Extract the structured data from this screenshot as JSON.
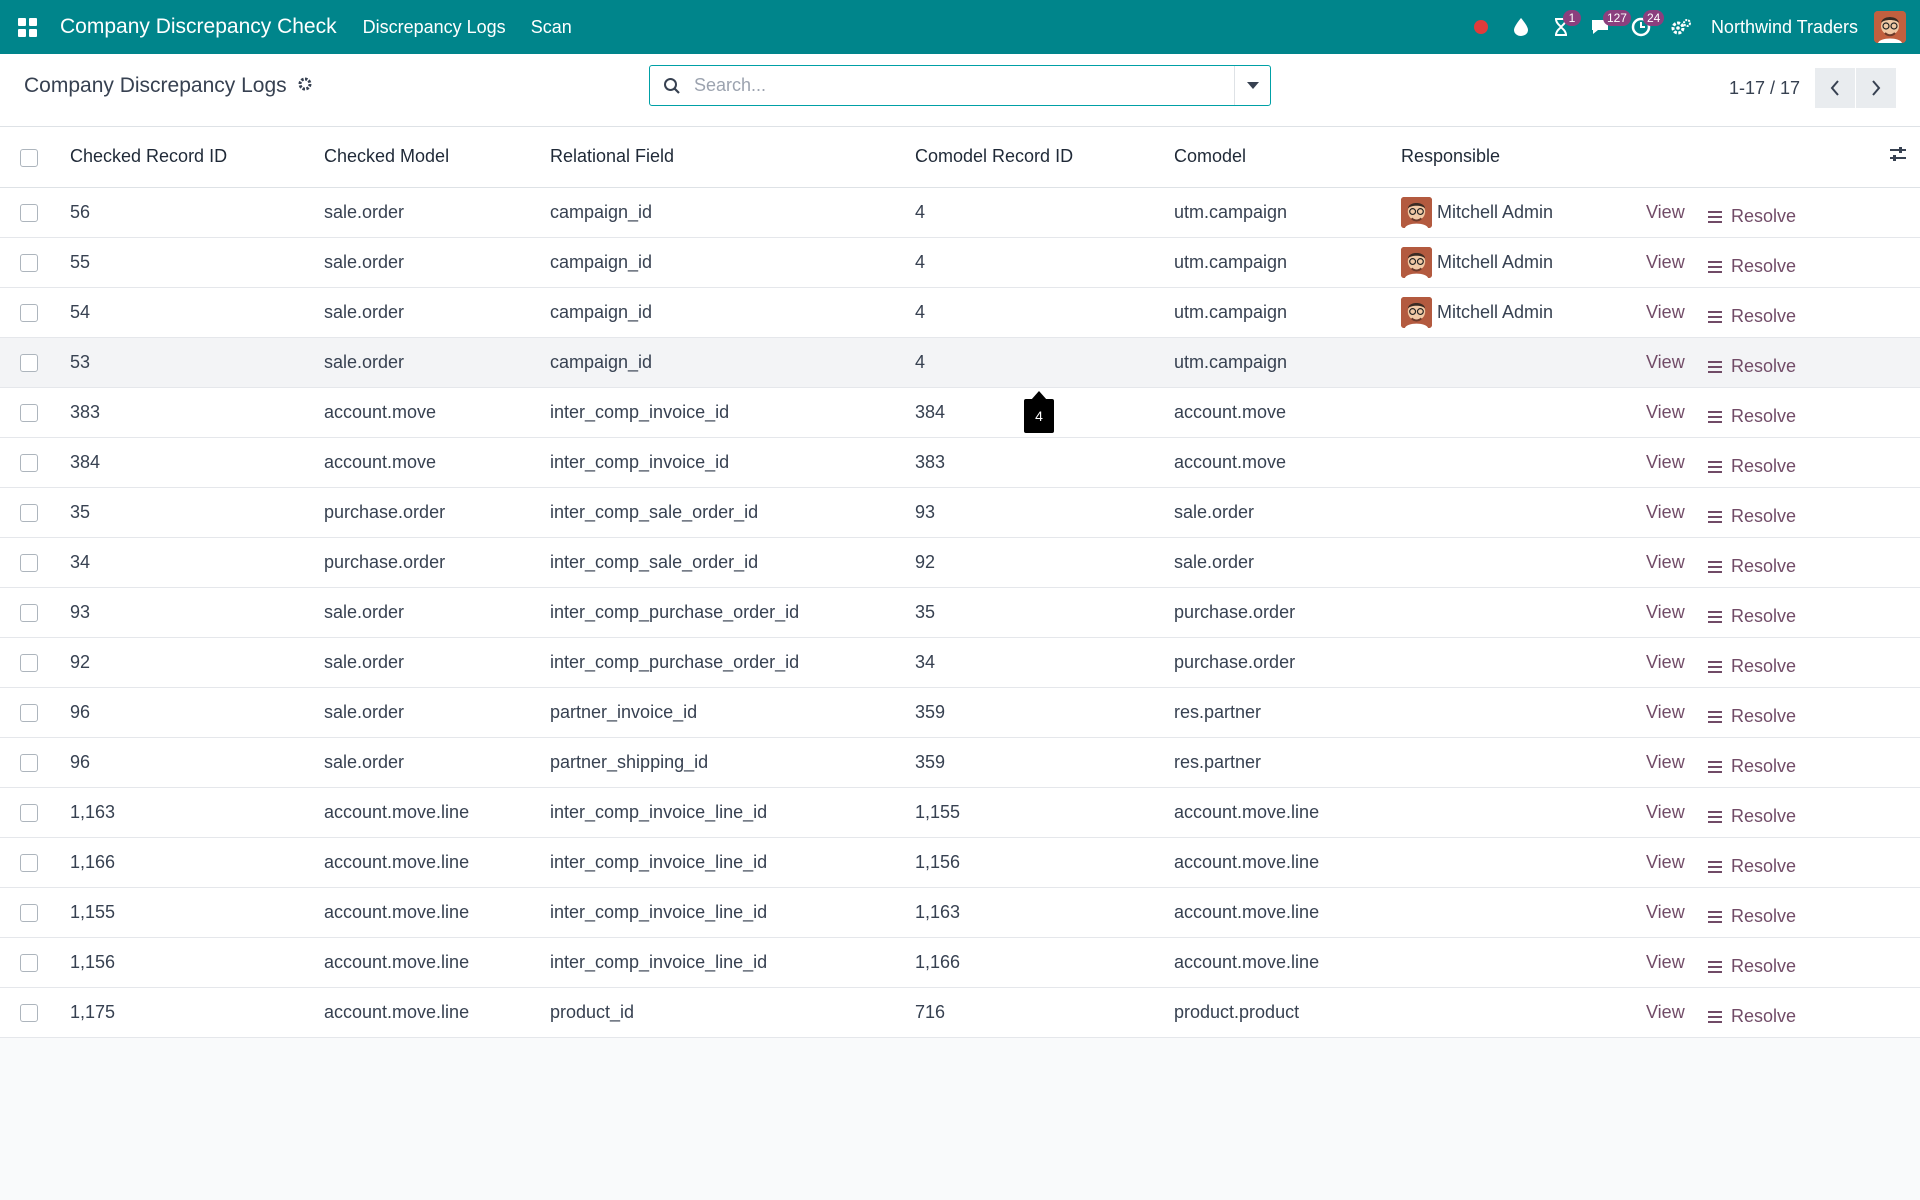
{
  "navbar": {
    "brand": "Company Discrepancy Check",
    "menus": [
      "Discrepancy Logs",
      "Scan"
    ],
    "badges": {
      "activities": "1",
      "messages": "127",
      "timesheets": "24"
    },
    "company": "Northwind Traders"
  },
  "control": {
    "title": "Company Discrepancy Logs",
    "search_placeholder": "Search...",
    "pager": "1-17 / 17"
  },
  "table": {
    "columns": [
      "Checked Record ID",
      "Checked Model",
      "Relational Field",
      "Comodel Record ID",
      "Comodel",
      "Responsible"
    ],
    "view_label": "View",
    "resolve_label": "Resolve",
    "rows": [
      {
        "record_id": "56",
        "model": "sale.order",
        "field": "campaign_id",
        "comodel_id": "4",
        "comodel": "utm.campaign",
        "responsible": "Mitchell Admin"
      },
      {
        "record_id": "55",
        "model": "sale.order",
        "field": "campaign_id",
        "comodel_id": "4",
        "comodel": "utm.campaign",
        "responsible": "Mitchell Admin"
      },
      {
        "record_id": "54",
        "model": "sale.order",
        "field": "campaign_id",
        "comodel_id": "4",
        "comodel": "utm.campaign",
        "responsible": "Mitchell Admin"
      },
      {
        "record_id": "53",
        "model": "sale.order",
        "field": "campaign_id",
        "comodel_id": "4",
        "comodel": "utm.campaign",
        "responsible": ""
      },
      {
        "record_id": "383",
        "model": "account.move",
        "field": "inter_comp_invoice_id",
        "comodel_id": "384",
        "comodel": "account.move",
        "responsible": ""
      },
      {
        "record_id": "384",
        "model": "account.move",
        "field": "inter_comp_invoice_id",
        "comodel_id": "383",
        "comodel": "account.move",
        "responsible": ""
      },
      {
        "record_id": "35",
        "model": "purchase.order",
        "field": "inter_comp_sale_order_id",
        "comodel_id": "93",
        "comodel": "sale.order",
        "responsible": ""
      },
      {
        "record_id": "34",
        "model": "purchase.order",
        "field": "inter_comp_sale_order_id",
        "comodel_id": "92",
        "comodel": "sale.order",
        "responsible": ""
      },
      {
        "record_id": "93",
        "model": "sale.order",
        "field": "inter_comp_purchase_order_id",
        "comodel_id": "35",
        "comodel": "purchase.order",
        "responsible": ""
      },
      {
        "record_id": "92",
        "model": "sale.order",
        "field": "inter_comp_purchase_order_id",
        "comodel_id": "34",
        "comodel": "purchase.order",
        "responsible": ""
      },
      {
        "record_id": "96",
        "model": "sale.order",
        "field": "partner_invoice_id",
        "comodel_id": "359",
        "comodel": "res.partner",
        "responsible": ""
      },
      {
        "record_id": "96",
        "model": "sale.order",
        "field": "partner_shipping_id",
        "comodel_id": "359",
        "comodel": "res.partner",
        "responsible": ""
      },
      {
        "record_id": "1,163",
        "model": "account.move.line",
        "field": "inter_comp_invoice_line_id",
        "comodel_id": "1,155",
        "comodel": "account.move.line",
        "responsible": ""
      },
      {
        "record_id": "1,166",
        "model": "account.move.line",
        "field": "inter_comp_invoice_line_id",
        "comodel_id": "1,156",
        "comodel": "account.move.line",
        "responsible": ""
      },
      {
        "record_id": "1,155",
        "model": "account.move.line",
        "field": "inter_comp_invoice_line_id",
        "comodel_id": "1,163",
        "comodel": "account.move.line",
        "responsible": ""
      },
      {
        "record_id": "1,156",
        "model": "account.move.line",
        "field": "inter_comp_invoice_line_id",
        "comodel_id": "1,166",
        "comodel": "account.move.line",
        "responsible": ""
      },
      {
        "record_id": "1,175",
        "model": "account.move.line",
        "field": "product_id",
        "comodel_id": "716",
        "comodel": "product.product",
        "responsible": ""
      }
    ]
  },
  "tooltip": {
    "text": "4"
  },
  "colors": {
    "navbar": "#00858b",
    "link": "#714b67",
    "badge": "#8b3f7e"
  }
}
